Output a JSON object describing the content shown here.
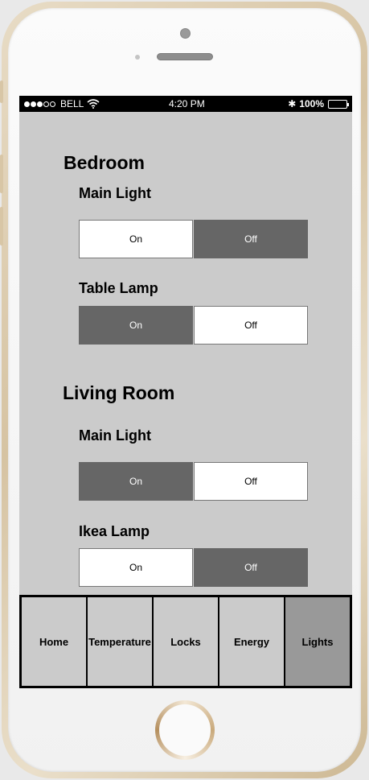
{
  "status_bar": {
    "carrier": "BELL",
    "time": "4:20 PM",
    "bluetooth": "✱",
    "battery": "100%"
  },
  "rooms": [
    {
      "name": "Bedroom",
      "devices": [
        {
          "name": "Main Light",
          "on_label": "On",
          "off_label": "Off",
          "state": "off"
        },
        {
          "name": "Table Lamp",
          "on_label": "On",
          "off_label": "Off",
          "state": "on"
        }
      ]
    },
    {
      "name": "Living Room",
      "devices": [
        {
          "name": "Main Light",
          "on_label": "On",
          "off_label": "Off",
          "state": "on"
        },
        {
          "name": "Ikea Lamp",
          "on_label": "On",
          "off_label": "Off",
          "state": "off"
        }
      ]
    }
  ],
  "tabs": [
    {
      "label": "Home"
    },
    {
      "label": "Temperature"
    },
    {
      "label": "Locks"
    },
    {
      "label": "Energy"
    },
    {
      "label": "Lights"
    }
  ],
  "selected_tab": "Lights",
  "colors": {
    "screen_bg": "#cbcbcb",
    "active_toggle": "#666666",
    "selected_tab": "#999999"
  }
}
